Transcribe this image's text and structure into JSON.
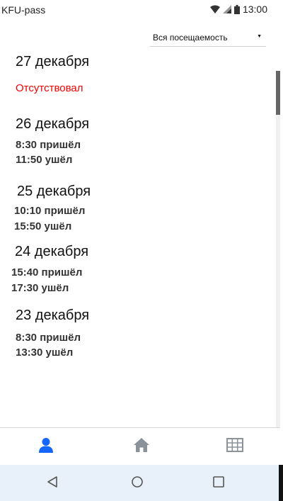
{
  "status_bar": {
    "app_name": "KFU-pass",
    "time": "13:00"
  },
  "filter": {
    "selected": "Вся посещаемость"
  },
  "days": [
    {
      "date": "27 декабря",
      "status": "Отсутствовал"
    },
    {
      "date": "26 декабря",
      "arrived": "8:30 пришёл",
      "left": "11:50 ушёл"
    },
    {
      "date": "25 декабря",
      "arrived": "10:10 пришёл",
      "left": "15:50 ушёл"
    },
    {
      "date": "24 декабря",
      "arrived": "15:40 пришёл",
      "left": "17:30 ушёл"
    },
    {
      "date": "23 декабря",
      "arrived": "8:30 пришёл",
      "left": "13:30 ушёл"
    }
  ],
  "bottom_nav": {
    "items": [
      "profile-icon",
      "home-icon",
      "table-icon"
    ],
    "active_color": "#1565ff",
    "inactive_color": "#8a929a"
  },
  "system_nav": {
    "items": [
      "back-icon",
      "home-circle-icon",
      "recents-icon"
    ]
  }
}
